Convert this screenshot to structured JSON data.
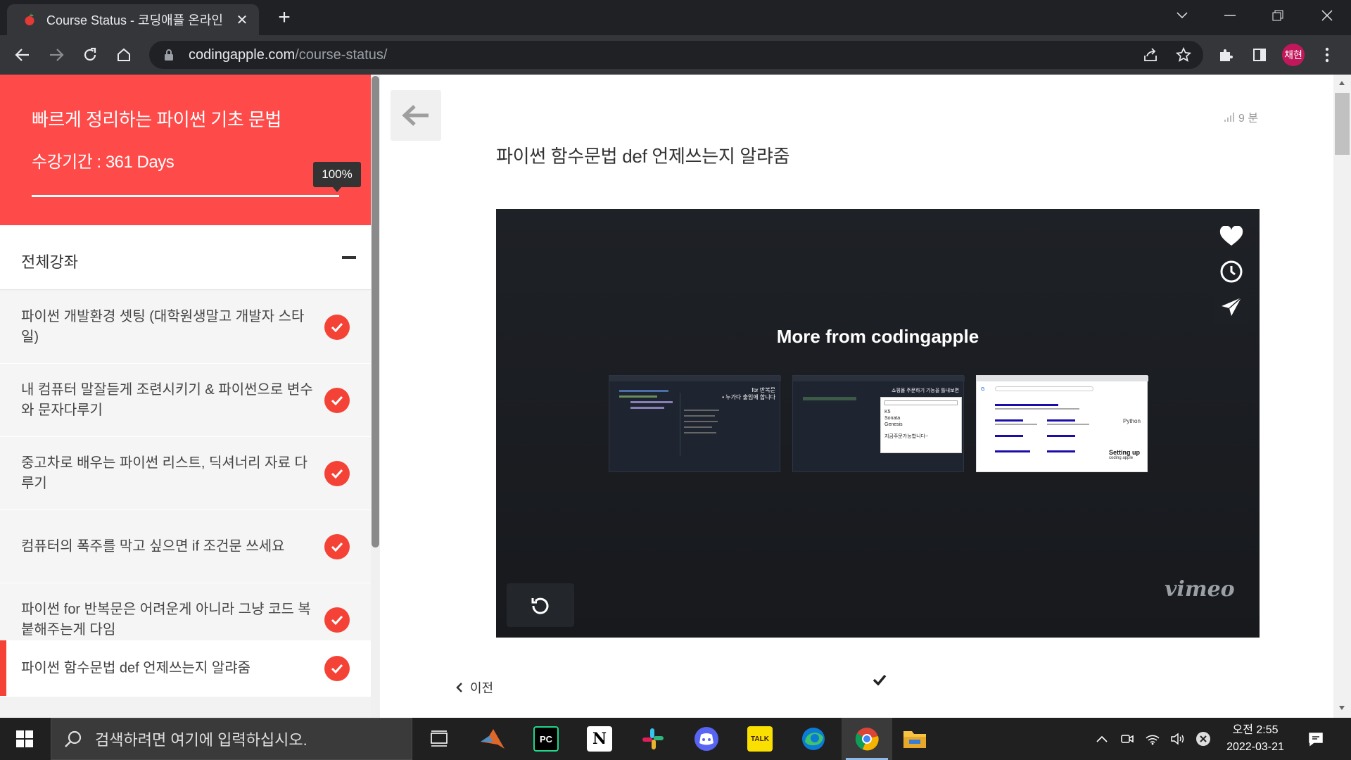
{
  "browser": {
    "tab_title": "Course Status - 코딩애플 온라인",
    "url_host": "codingapple.com",
    "url_path": "/course-status/",
    "profile_label": "채현"
  },
  "sidebar": {
    "course_title": "빠르게 정리하는 파이썬 기초 문법",
    "period": "수강기간 : 361 Days",
    "progress_label": "100%",
    "progress": 1.0,
    "section_label": "전체강좌",
    "lessons": [
      {
        "title": "파이썬 개발환경 셋팅 (대학원생말고 개발자 스타일)",
        "done": true
      },
      {
        "title": "내 컴퓨터 말잘듣게 조련시키기 & 파이썬으로 변수와 문자다루기",
        "done": true
      },
      {
        "title": "중고차로 배우는 파이썬 리스트, 딕셔너리 자료 다루기",
        "done": true
      },
      {
        "title": "컴퓨터의 폭주를 막고 싶으면 if 조건문 쓰세요",
        "done": true
      },
      {
        "title": "파이썬 for 반복문은 어려운게 아니라 그냥 코드 복붙해주는게 다임",
        "done": true
      },
      {
        "title": "파이썬 함수문법 def 언제쓰는지 알랴줌",
        "done": true,
        "current": true
      }
    ]
  },
  "main": {
    "duration": "9 분",
    "lesson_title": "파이썬 함수문법 def 언제쓰는지 알랴줌",
    "video": {
      "more_from": "More from codingapple",
      "brand": "vimeo",
      "thumb1_caption": "for 반복문",
      "thumb1_sub": "• 누가다 출입에 합니다",
      "thumb2_caption": "쇼핑몰 주문하기 기능을 틀내보면",
      "thumb2_items": [
        "K5",
        "Sonata",
        "Genesis"
      ],
      "thumb2_note": "지금주문가능합니다~",
      "thumb3_caption": "Python",
      "thumb3_sub": "Setting up",
      "thumb3_sub2": "coding apple"
    },
    "prev_label": "이전"
  },
  "taskbar": {
    "search_placeholder": "검색하려면 여기에 입력하십시오.",
    "time": "오전 2:55",
    "date": "2022-03-21"
  },
  "colors": {
    "accent": "#ff4a4a",
    "check": "#f44336"
  }
}
